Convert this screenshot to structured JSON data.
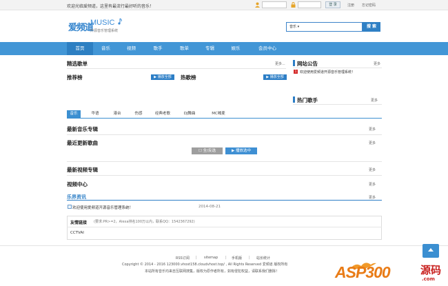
{
  "topbar": {
    "welcome": "欢迎光临爱频道，这里有最流行最好听的音乐！",
    "login_btn": "登 录",
    "register": "注册",
    "forgot": "忘记密码"
  },
  "logo": {
    "cn": "爱频道",
    "en": "MUSIC",
    "sub": "开源音乐管理系统"
  },
  "search": {
    "select": "音乐",
    "button": "搜 索"
  },
  "nav": [
    "首页",
    "音乐",
    "视频",
    "歌手",
    "歌单",
    "专辑",
    "娱乐",
    "会员中心"
  ],
  "sections": {
    "featured_playlist": "精选歌单",
    "recommend_chart": "推荐榜",
    "hot_chart": "热歌榜",
    "play_all": "播放全部",
    "notice": "网站公告",
    "notice_item": "欢迎使用爱频道开源音乐管理系统！",
    "hot_singers": "热门歌手",
    "new_albums": "最新音乐专辑",
    "new_songs": "最近更新歌曲",
    "select_all": "全/反选",
    "play_selected": "播放选中",
    "new_videos": "最新视频专辑",
    "video_center": "视频中心",
    "news": "乐界资讯",
    "more": "更多",
    "more_dots": "更多..."
  },
  "tabs": [
    "音乐",
    "华语",
    "港台",
    "伤感",
    "经典老歌",
    "DJ舞曲",
    "MC喊麦"
  ],
  "news": {
    "item": "欢迎使用爱频道开源音乐管理系统！",
    "date": "2014-08-21"
  },
  "friends": {
    "title": "友情链接",
    "note": "(要求:PR>=2，Alexa排名100万以内，联系QQ：1542367292)",
    "link": "CCTVAI"
  },
  "footer": {
    "links": [
      "RSS订阅",
      "sitemap",
      "手机版",
      "站长统计"
    ],
    "copyright": "Copyright © 2014 - 2016 123000.vhost158.cloudvhost.top/ , All Rights Reserved 爱频道 版权所有",
    "note": "本站所有音乐均来自互联网搜集，版权为原作者所有，如有侵犯权益，请联系我们删除！"
  },
  "watermark": {
    "asp": "ASP300",
    "cn": "源码",
    "url": ".com"
  },
  "colors": {
    "nav": "#4296d6",
    "nav_active": "#2d7fc2",
    "accent": "#2c7ec6",
    "notice_badge": "#d42b2b"
  }
}
